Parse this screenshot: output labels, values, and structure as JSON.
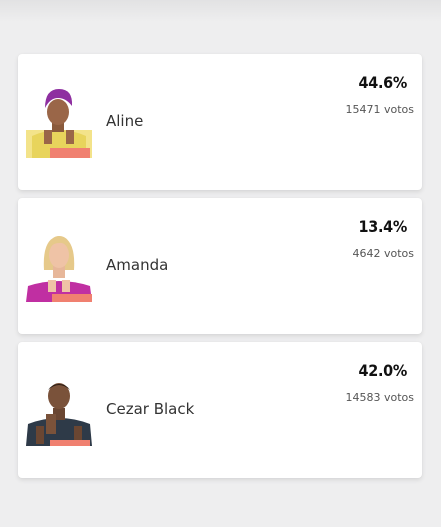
{
  "candidates": [
    {
      "name": "Aline",
      "percent": "44.6%",
      "votes": "15471 votos",
      "percent_value": 44.6
    },
    {
      "name": "Amanda",
      "percent": "13.4%",
      "votes": "4642 votos",
      "percent_value": 13.4
    },
    {
      "name": "Cezar Black",
      "percent": "42.0%",
      "votes": "14583 votos",
      "percent_value": 42.0
    }
  ],
  "colors": {
    "background": "#eeeeef",
    "card": "#ffffff",
    "pedestal": "#f08070"
  }
}
